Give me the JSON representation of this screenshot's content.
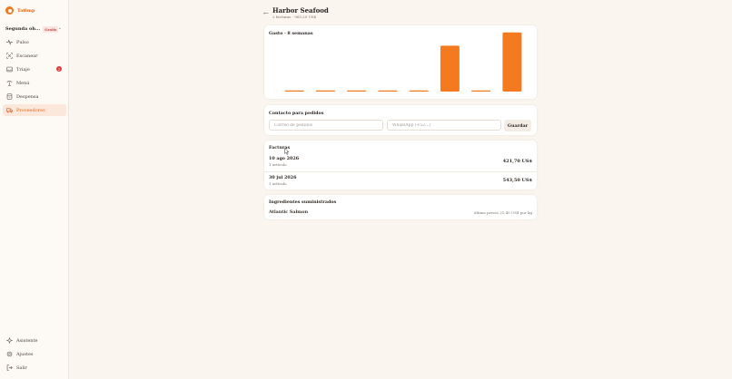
{
  "brand": {
    "name": "Tatimp"
  },
  "restaurant": {
    "name": "Segunda oh...",
    "plan": "Gratis"
  },
  "nav": [
    {
      "label": "Pulso",
      "icon": "pulse-icon"
    },
    {
      "label": "Escanear",
      "icon": "scan-icon"
    },
    {
      "label": "Triaje",
      "icon": "inbox-icon",
      "count": "2"
    },
    {
      "label": "Menú",
      "icon": "menu-icon"
    },
    {
      "label": "Despensa",
      "icon": "pantry-icon"
    },
    {
      "label": "Proveedores",
      "icon": "truck-icon",
      "active": true
    }
  ],
  "bottom_nav": [
    {
      "label": "Asistente",
      "icon": "assistant-icon"
    },
    {
      "label": "Ajustes",
      "icon": "gear-icon"
    },
    {
      "label": "Salir",
      "icon": "logout-icon"
    }
  ],
  "header": {
    "title": "Harbor Seafood",
    "subtitle": "2 facturas · 965,20 US$"
  },
  "chart": {
    "title": "Gasto · 8 semanas",
    "bar_color": "#f47a1f"
  },
  "chart_data": {
    "type": "bar",
    "title": "Gasto · 8 semanas",
    "categories": [
      "1",
      "2",
      "3",
      "4",
      "5",
      "6",
      "7",
      "8"
    ],
    "values": [
      0,
      0,
      0,
      0,
      0,
      421.7,
      0,
      543.5
    ],
    "ylim": [
      0,
      450
    ],
    "grid": false
  },
  "contact": {
    "title": "Contacto para pedidos",
    "email_placeholder": "Correo de pedidos",
    "whatsapp_placeholder": "WhatsApp (+52...)",
    "save_label": "Guardar"
  },
  "invoices": {
    "title": "Facturas",
    "rows": [
      {
        "date": "10 ago 2026",
        "items": "1 artículo",
        "amount": "421,70 US$"
      },
      {
        "date": "30 jul 2026",
        "items": "1 artículo",
        "amount": "543,50 US$"
      }
    ]
  },
  "ingredients": {
    "title": "Ingredientes suministrados",
    "items": [
      {
        "name": "Atlantic Salmon",
        "price": "último precio 21,40 US$ por kg"
      }
    ]
  }
}
